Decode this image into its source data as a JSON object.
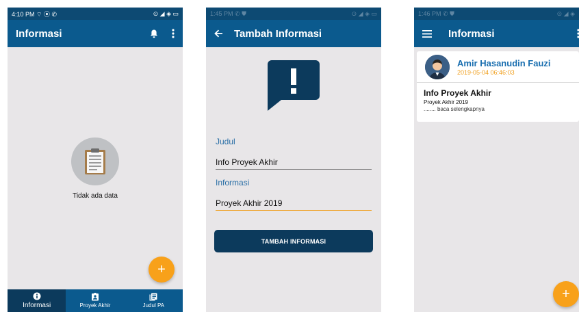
{
  "screen1": {
    "status": {
      "time": "4:10 PM",
      "left_icons": "⌔ ⦿ ✆",
      "right_icons": "⊙ ◢ ◈ ▭"
    },
    "appbar": {
      "title": "Informasi",
      "bell_icon": "bell-icon",
      "menu_icon": "more-vert-icon"
    },
    "empty": {
      "icon": "clipboard-icon",
      "text": "Tidak ada data"
    },
    "fab": {
      "label": "+"
    },
    "nav": [
      {
        "label": "Informasi",
        "icon": "info-icon",
        "active": true
      },
      {
        "label": "Proyek Akhir",
        "icon": "badge-icon",
        "active": false
      },
      {
        "label": "Judul PA",
        "icon": "document-icon",
        "active": false
      }
    ]
  },
  "screen2": {
    "status": {
      "time": "1:45 PM",
      "left_icons": "✆ ⛊",
      "right_icons": "⊙ ◢ ◈ ▭"
    },
    "appbar": {
      "title": "Tambah Informasi",
      "back_icon": "back-arrow-icon"
    },
    "form": {
      "judul_label": "Judul",
      "judul_value": "Info Proyek Akhir",
      "informasi_label": "Informasi",
      "informasi_value": "Proyek Akhir 2019",
      "submit_label": "TAMBAH INFORMASI"
    }
  },
  "screen3": {
    "status": {
      "time": "1:46 PM",
      "left_icons": "✆ ⛊",
      "right_icons": "⊙ ◢ ◈"
    },
    "appbar": {
      "title": "Informasi",
      "menu_icon": "hamburger-icon"
    },
    "card": {
      "name": "Amir Hasanudin Fauzi",
      "timestamp": "2019-05-04 06:46:03",
      "title": "Info Proyek Akhir",
      "subtitle": "Proyek Akhir 2019",
      "more": "........ baca selengkapnya"
    },
    "fab": {
      "label": "+"
    }
  },
  "colors": {
    "primary": "#0b5a8e",
    "primary_dark": "#0c3a5c",
    "accent": "#f8a11a",
    "background": "#e8e6e8"
  }
}
